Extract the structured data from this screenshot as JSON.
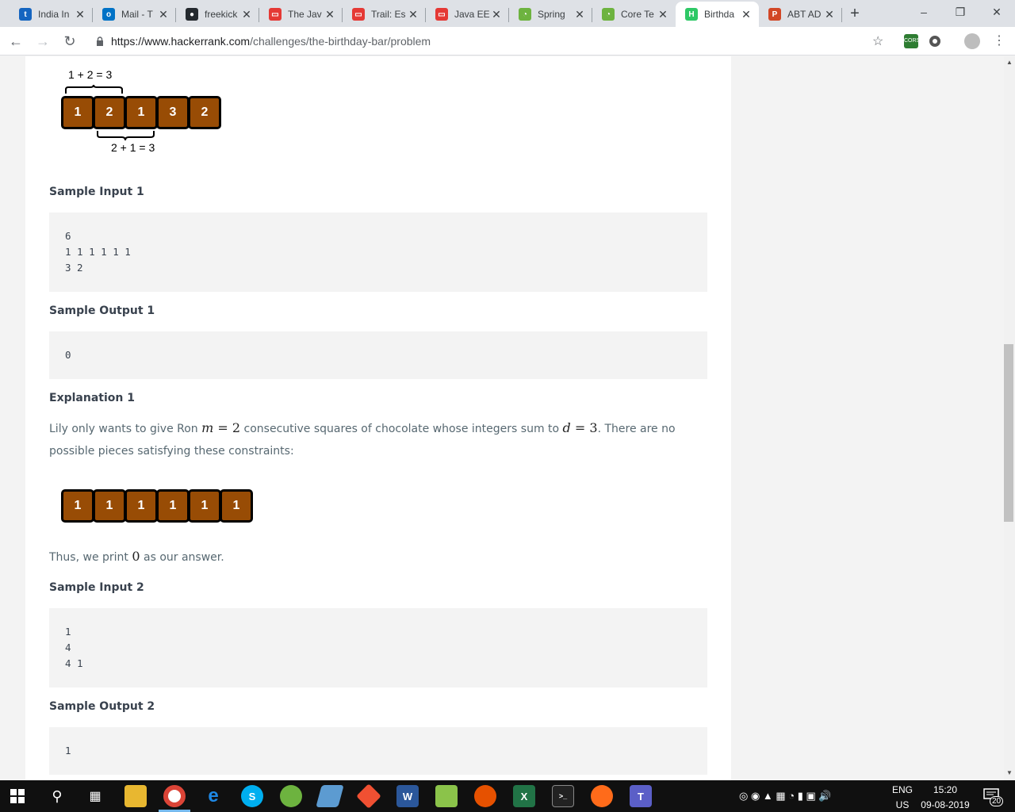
{
  "browser": {
    "tabs": [
      {
        "title": "India In",
        "color": "#1565c0",
        "glyph": "t"
      },
      {
        "title": "Mail - T",
        "color": "#0072c6",
        "glyph": "o"
      },
      {
        "title": "freekick",
        "color": "#24292e",
        "glyph": "●"
      },
      {
        "title": "The Jav",
        "color": "#e53935",
        "glyph": "▭"
      },
      {
        "title": "Trail: Es",
        "color": "#e53935",
        "glyph": "▭"
      },
      {
        "title": "Java EE",
        "color": "#e53935",
        "glyph": "▭"
      },
      {
        "title": "Spring",
        "color": "#6db33f",
        "glyph": "◔"
      },
      {
        "title": "Core Te",
        "color": "#6db33f",
        "glyph": "◔"
      },
      {
        "title": "Birthda",
        "color": "#2ec866",
        "glyph": "H"
      },
      {
        "title": "ABT AD",
        "color": "#d24726",
        "glyph": "P"
      }
    ],
    "url_host": "https://www.hackerrank.com",
    "url_path": "/challenges/the-birthday-bar/problem"
  },
  "diagram1": {
    "top_label": "1 + 2 = 3",
    "squares": [
      "1",
      "2",
      "1",
      "3",
      "2"
    ],
    "bottom_label": "2 + 1 = 3"
  },
  "sample_input_1": {
    "heading": "Sample Input 1",
    "code": "6\n1 1 1 1 1 1\n3 2"
  },
  "sample_output_1": {
    "heading": "Sample Output 1",
    "code": "0"
  },
  "explanation_1": {
    "heading": "Explanation 1",
    "text_a": "Lily only wants to give Ron ",
    "m_var": "m",
    "m_eq": " = 2",
    "text_b": " consecutive squares of chocolate whose integers sum to ",
    "d_var": "d",
    "d_eq": " = 3",
    "text_c": ". There are no possible pieces satisfying these constraints:",
    "squares": [
      "1",
      "1",
      "1",
      "1",
      "1",
      "1"
    ],
    "thus_a": "Thus, we print ",
    "thus_val": "0",
    "thus_b": " as our answer."
  },
  "sample_input_2": {
    "heading": "Sample Input 2",
    "code": "1\n4\n4 1"
  },
  "sample_output_2": {
    "heading": "Sample Output 2",
    "code": "1"
  },
  "taskbar": {
    "lang": "ENG",
    "region": "US",
    "time": "15:20",
    "date": "09-08-2019",
    "notif_count": "20"
  },
  "colors": {
    "chocolate": "#984c05",
    "heading": "#39424e",
    "body_text": "#576871"
  }
}
